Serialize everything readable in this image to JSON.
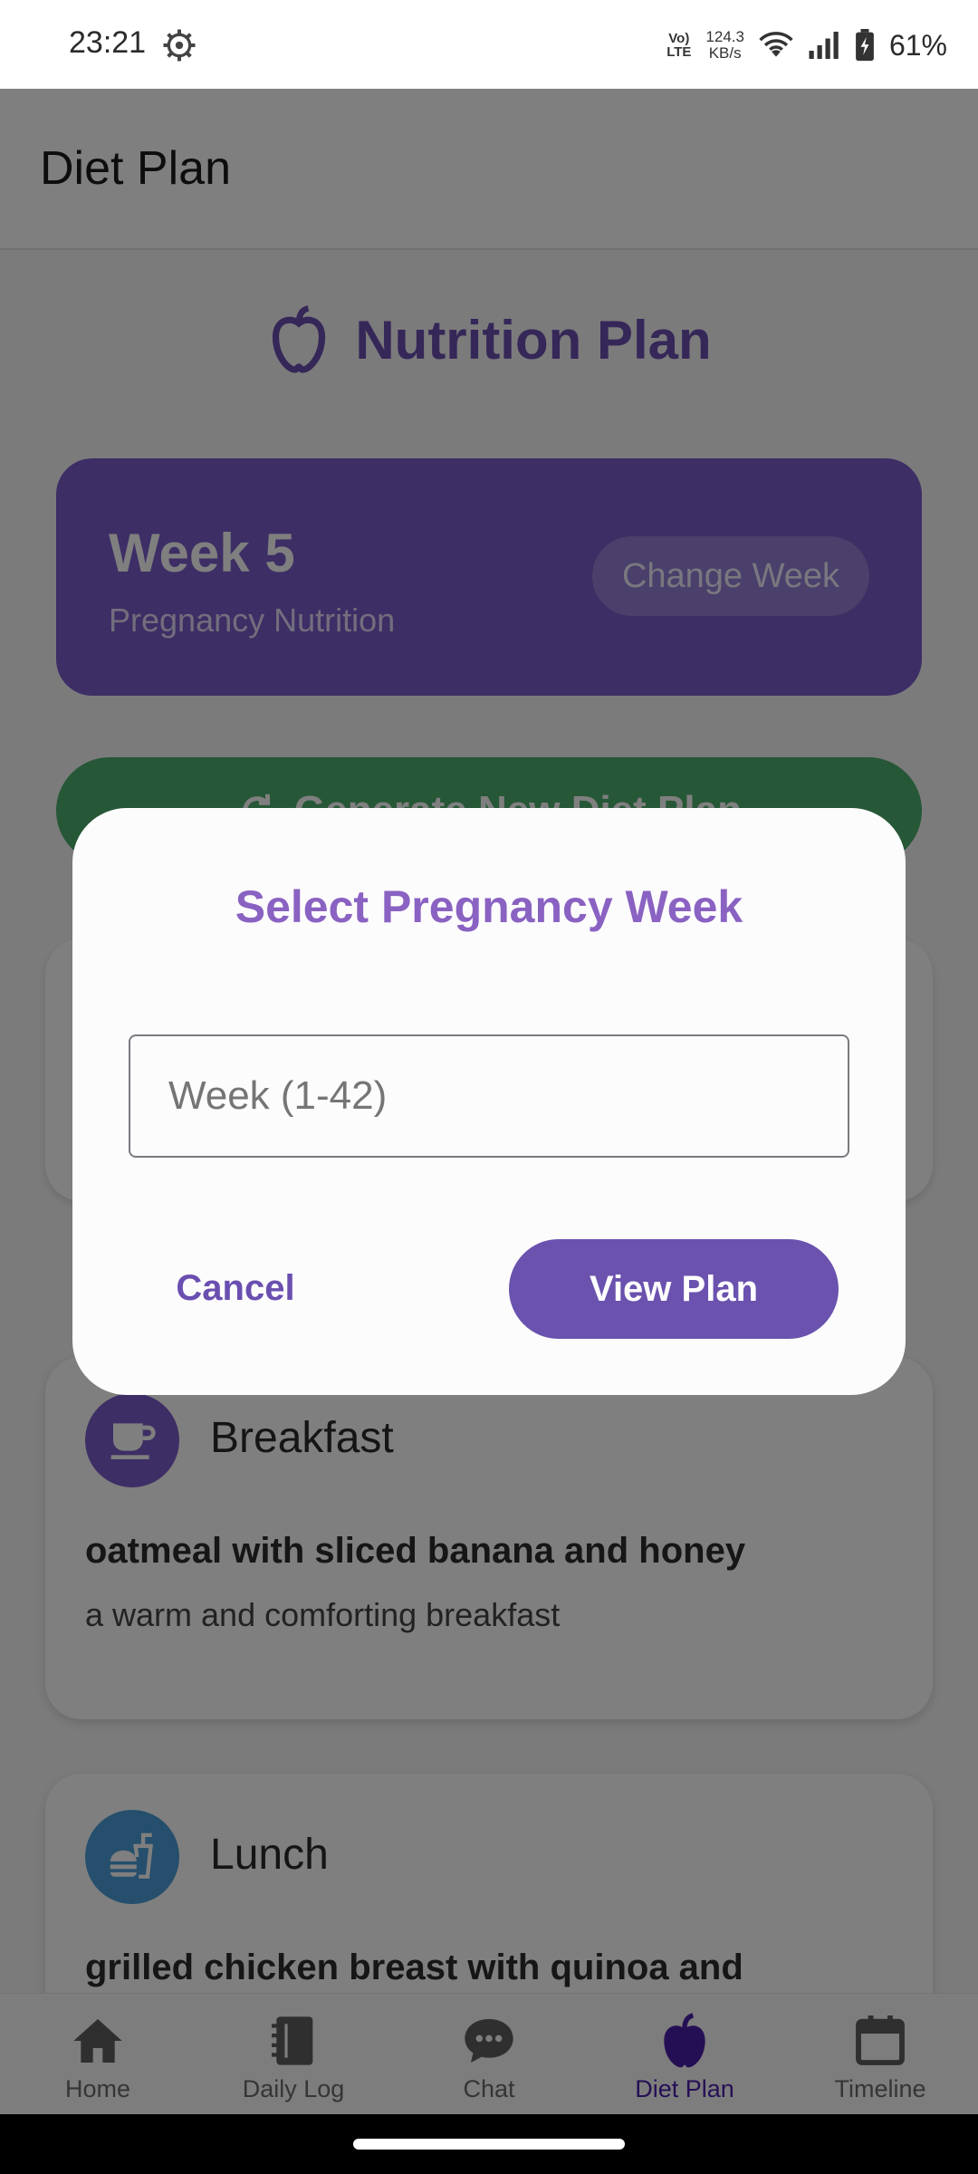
{
  "status_bar": {
    "time": "23:21",
    "network_type_top": "Vo)",
    "network_type_bottom": "LTE",
    "speed_value": "124.3",
    "speed_unit": "KB/s",
    "battery": "61%"
  },
  "app_bar": {
    "title": "Diet Plan"
  },
  "header": {
    "title": "Nutrition Plan",
    "icon": "apple-icon"
  },
  "week_card": {
    "title": "Week 5",
    "subtitle": "Pregnancy Nutrition",
    "change_label": "Change Week"
  },
  "generate_button": {
    "label": "Generate New Diet Plan"
  },
  "meals": [
    {
      "name": "Breakfast",
      "icon": "coffee-cup-icon",
      "color": "#7a5ccb",
      "food": "oatmeal with sliced banana and honey",
      "description": "a warm and comforting breakfast"
    },
    {
      "name": "Lunch",
      "icon": "fastfood-icon",
      "color": "#4a9fd8",
      "food": "grilled chicken breast with quinoa and",
      "description": ""
    }
  ],
  "dialog": {
    "title": "Select Pregnancy Week",
    "input_placeholder": "Week (1-42)",
    "cancel_label": "Cancel",
    "confirm_label": "View Plan"
  },
  "bottom_nav": {
    "items": [
      {
        "label": "Home",
        "icon": "home-icon",
        "active": false
      },
      {
        "label": "Daily Log",
        "icon": "journal-icon",
        "active": false
      },
      {
        "label": "Chat",
        "icon": "chat-icon",
        "active": false
      },
      {
        "label": "Diet Plan",
        "icon": "apple-icon",
        "active": true
      },
      {
        "label": "Timeline",
        "icon": "calendar-icon",
        "active": false
      }
    ]
  },
  "colors": {
    "primary": "#6a4fb0",
    "week_card": "#7a5ccb",
    "generate": "#4caf6d",
    "scrim": "rgba(0,0,0,0.5)",
    "active_nav": "#4a1fa8"
  }
}
